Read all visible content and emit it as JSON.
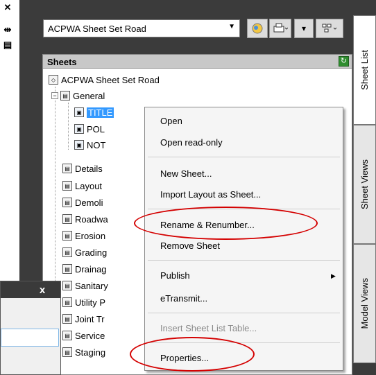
{
  "left_strip": {
    "icons": [
      "close-icon",
      "autohide-icon",
      "properties-icon"
    ]
  },
  "toolbar": {
    "sheet_set_name": "ACPWA Sheet Set Road",
    "buttons": [
      "sheet-set-icon",
      "publish-icon",
      "views-icon"
    ]
  },
  "sheets_panel": {
    "title": "Sheets",
    "root": "ACPWA Sheet Set Road",
    "group": "General",
    "group_children": [
      "TITLE",
      "POL",
      "NOT"
    ],
    "subsets": [
      "Details",
      "Layout",
      "Demoli",
      "Roadwa",
      "Erosion",
      "Grading",
      "Drainag",
      "Sanitary",
      "Utility P",
      "Joint Tr",
      "Service",
      "Staging"
    ]
  },
  "tabs": [
    "Sheet List",
    "Sheet Views",
    "Model Views"
  ],
  "context_menu": {
    "items": [
      {
        "label": "Open",
        "enabled": true
      },
      {
        "label": "Open read-only",
        "enabled": true
      },
      {
        "label": "New Sheet...",
        "enabled": true
      },
      {
        "label": "Import Layout as Sheet...",
        "enabled": true
      },
      {
        "label": "Rename & Renumber...",
        "enabled": true
      },
      {
        "label": "Remove Sheet",
        "enabled": true
      },
      {
        "label": "Publish",
        "enabled": true,
        "submenu": true
      },
      {
        "label": "eTransmit...",
        "enabled": true
      },
      {
        "label": "Insert Sheet List Table...",
        "enabled": false
      },
      {
        "label": "Properties...",
        "enabled": true
      }
    ]
  },
  "highlights": {
    "color": "#d40000",
    "circled_items": [
      "Rename & Renumber...",
      "Properties..."
    ]
  },
  "dialog": {
    "close_label": "x",
    "input_value": ""
  }
}
